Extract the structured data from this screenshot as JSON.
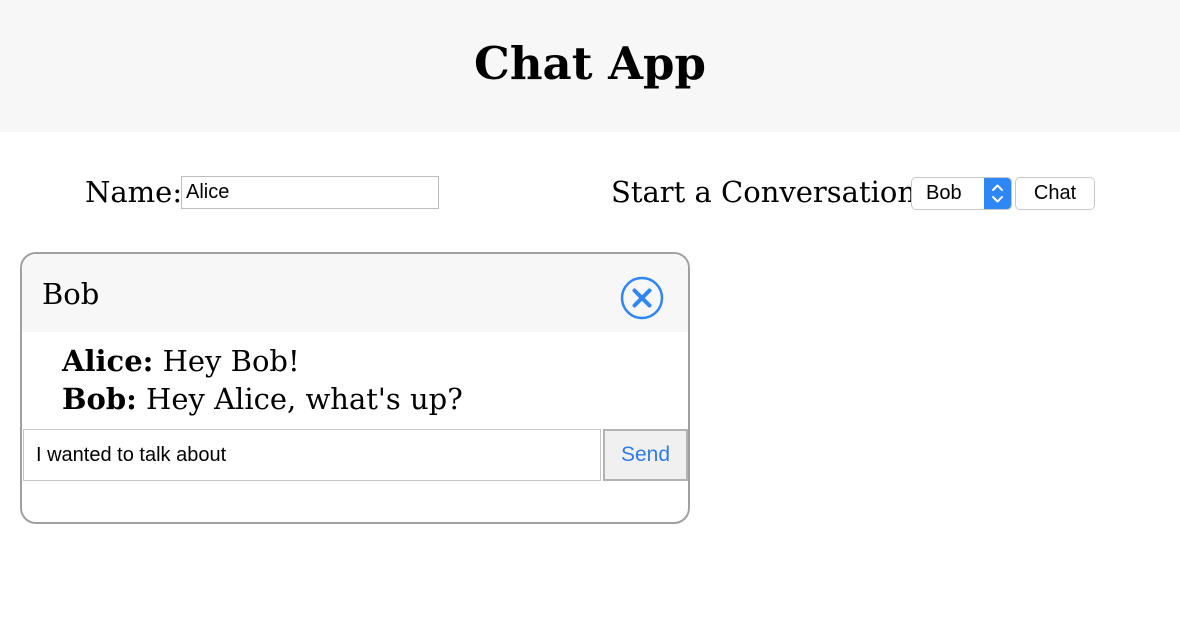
{
  "app": {
    "title": "Chat App"
  },
  "form": {
    "name_label": "Name:",
    "name_value": "Alice",
    "conversation_label": "Start a Conversation:",
    "selected_user": "Bob",
    "chat_button_label": "Chat"
  },
  "chat": {
    "partner": "Bob",
    "messages": [
      {
        "sender": "Alice:",
        "text": " Hey Bob!"
      },
      {
        "sender": "Bob:",
        "text": " Hey Alice, what's up?"
      }
    ],
    "draft": "I wanted to talk about",
    "send_label": "Send"
  },
  "colors": {
    "accent": "#2f86f5",
    "header_bg": "#f7f7f7",
    "send_text": "#2f7ce8"
  },
  "icons": {
    "close": "close-circle-icon",
    "select_arrows": "chevron-up-down-icon"
  }
}
